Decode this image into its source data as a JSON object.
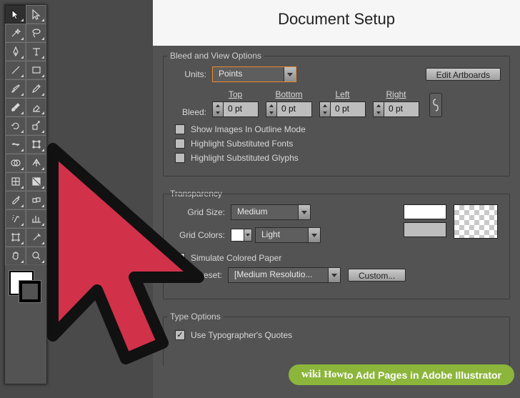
{
  "panel": {
    "title": "Document Setup",
    "bleed": {
      "legend": "Bleed and View Options",
      "units_label": "Units:",
      "units_value": "Points",
      "edit_artboards": "Edit Artboards",
      "bleed_label": "Bleed:",
      "cols": {
        "top": "Top",
        "bottom": "Bottom",
        "left": "Left",
        "right": "Right"
      },
      "values": {
        "top": "0 pt",
        "bottom": "0 pt",
        "left": "0 pt",
        "right": "0 pt"
      },
      "chk_outline": "Show Images In Outline Mode",
      "chk_fonts": "Highlight Substituted Fonts",
      "chk_glyphs": "Highlight Substituted Glyphs"
    },
    "transparency": {
      "legend": "Transparency",
      "grid_size_label": "Grid Size:",
      "grid_size_value": "Medium",
      "grid_colors_label": "Grid Colors:",
      "grid_colors_value": "Light",
      "simulate": "Simulate Colored Paper",
      "preset_label": "Preset:",
      "preset_value": "[Medium Resolutio...",
      "custom": "Custom..."
    },
    "type": {
      "legend": "Type Options",
      "typographers": "Use Typographer's Quotes"
    }
  },
  "credit": {
    "brand": "wikiHow",
    "text": " to Add Pages in Adobe Illustrator"
  },
  "colors": {
    "accent": "#e88b2e",
    "cursor_fill": "#d13149",
    "cursor_stroke": "#111111"
  },
  "tools": [
    [
      "selection",
      "direct-selection"
    ],
    [
      "magic-wand",
      "lasso"
    ],
    [
      "pen",
      "type"
    ],
    [
      "line",
      "rectangle"
    ],
    [
      "paintbrush",
      "pencil"
    ],
    [
      "blob-brush",
      "eraser"
    ],
    [
      "rotate",
      "scale"
    ],
    [
      "width",
      "free-transform"
    ],
    [
      "shape-builder",
      "perspective-grid"
    ],
    [
      "mesh",
      "gradient"
    ],
    [
      "eyedropper",
      "blend"
    ],
    [
      "symbol-sprayer",
      "column-graph"
    ],
    [
      "artboard",
      "slice"
    ],
    [
      "hand",
      "zoom"
    ]
  ]
}
